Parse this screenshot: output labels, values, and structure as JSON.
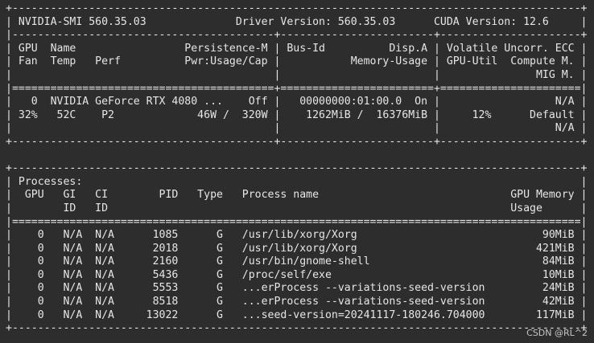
{
  "header_lines": [
    "+-----------------------------------------------------------------------------------------+",
    "| NVIDIA-SMI 560.35.03              Driver Version: 560.35.03      CUDA Version: 12.6     |",
    "|-----------------------------------------+------------------------+----------------------+",
    "| GPU  Name                 Persistence-M | Bus-Id          Disp.A | Volatile Uncorr. ECC |",
    "| Fan  Temp   Perf          Pwr:Usage/Cap |           Memory-Usage | GPU-Util  Compute M. |",
    "|                                         |                        |               MIG M. |",
    "|=========================================+========================+======================|",
    "|   0  NVIDIA GeForce RTX 4080 ...    Off |   00000000:01:00.0  On |                  N/A |",
    "| 32%   52C    P2             46W /  320W |    1262MiB /  16376MiB |     12%      Default |",
    "|                                         |                        |                  N/A |",
    "+-----------------------------------------+------------------------+----------------------+"
  ],
  "process_lines": [
    "+-----------------------------------------------------------------------------------------+",
    "| Processes:                                                                              |",
    "|  GPU   GI   CI        PID   Type   Process name                              GPU Memory |",
    "|        ID   ID                                                               Usage      |",
    "|=========================================================================================|",
    "|    0   N/A  N/A      1085      G   /usr/lib/xorg/Xorg                             90MiB |",
    "|    0   N/A  N/A      2018      G   /usr/lib/xorg/Xorg                            421MiB |",
    "|    0   N/A  N/A      2160      G   /usr/bin/gnome-shell                           84MiB |",
    "|    0   N/A  N/A      5436      G   /proc/self/exe                                 10MiB |",
    "|    0   N/A  N/A      5553      G   ...erProcess --variations-seed-version         24MiB |",
    "|    0   N/A  N/A      8518      G   ...erProcess --variations-seed-version         42MiB |",
    "|    0   N/A  N/A     13022      G   ...seed-version=20241117-180246.704000        117MiB |",
    "+-----------------------------------------------------------------------------------------+"
  ],
  "watermark": "CSDN @RL^2"
}
